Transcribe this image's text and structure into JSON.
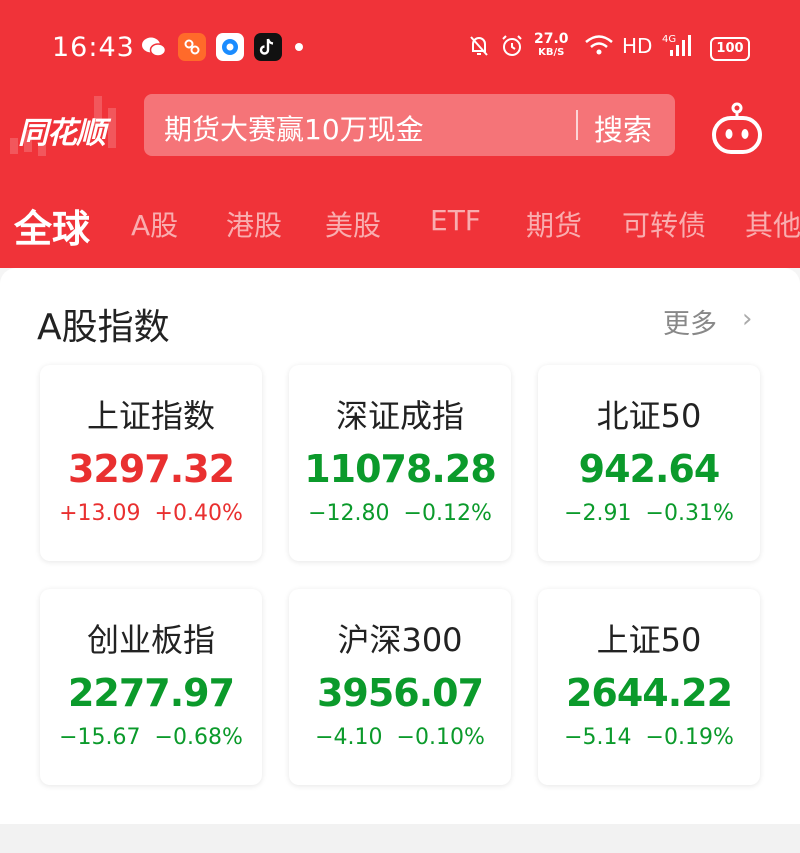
{
  "statusbar": {
    "time": "16:43",
    "apps": [
      "wechat-icon",
      "app-icon",
      "browser-icon",
      "tiktok-icon"
    ],
    "speed_top": "27.0",
    "speed_bottom": "KB/S",
    "network": "HD",
    "signal": "4G",
    "battery": "100"
  },
  "header": {
    "logo": "同花顺",
    "search_placeholder": "期货大赛赢10万现金",
    "search_button": "搜索"
  },
  "tabs": [
    {
      "label": "全球",
      "active": true
    },
    {
      "label": "A股"
    },
    {
      "label": "港股"
    },
    {
      "label": "美股"
    },
    {
      "label": "ETF"
    },
    {
      "label": "期货"
    },
    {
      "label": "可转债"
    },
    {
      "label": "其他"
    }
  ],
  "section": {
    "title": "A股指数",
    "more": "更多",
    "chevron": "›"
  },
  "indices": [
    {
      "name": "上证指数",
      "value": "3297.32",
      "change": "+13.09  +0.40%",
      "trend": "up"
    },
    {
      "name": "深证成指",
      "value": "11078.28",
      "change": "−12.80  −0.12%",
      "trend": "down"
    },
    {
      "name": "北证50",
      "value": "942.64",
      "change": "−2.91  −0.31%",
      "trend": "down"
    },
    {
      "name": "创业板指",
      "value": "2277.97",
      "change": "−15.67  −0.68%",
      "trend": "down"
    },
    {
      "name": "沪深300",
      "value": "3956.07",
      "change": "−4.10  −0.10%",
      "trend": "down"
    },
    {
      "name": "上证50",
      "value": "2644.22",
      "change": "−5.14  −0.19%",
      "trend": "down"
    }
  ],
  "colors": {
    "brand_red": "#f03339",
    "up": "#e93030",
    "down": "#0b9a2b"
  }
}
